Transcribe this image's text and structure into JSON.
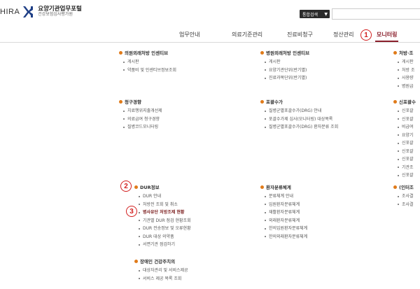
{
  "header": {
    "logo_left": "HIRA",
    "logo_title": "요양기관업무포털",
    "logo_sub": "건강보험심사평가원",
    "search_select": "통합검색",
    "search_input": ""
  },
  "nav": {
    "items": [
      "업무안내",
      "의료기준관리",
      "진료비청구",
      "정산관리",
      "모니터링"
    ],
    "active": "모니터링"
  },
  "annotations": [
    "1",
    "2",
    "3"
  ],
  "columns": {
    "col1": [
      {
        "title": "의원외래처방 인센티브",
        "items": [
          "게시판",
          "약품비 및 인센티브정보조회"
        ]
      },
      {
        "title": "청구경향",
        "items": [
          "치료행위지출개선제",
          "의료급여 청구경향",
          "질병코드모니터링"
        ]
      },
      {
        "title": "DUR정보",
        "items": [
          "DUR 안내",
          "처방전 조회 및 취소",
          "병사유단 처방조제 현황",
          "기관별 DUR 점검 현황조회",
          "DUR 전송정보 및 오류현황",
          "DUR 대상 의약품",
          "서면기관 점검하기"
        ],
        "highlight": 2
      },
      {
        "title": "장애인 건강주치의",
        "items": [
          "대상자관리 및 서비스제공",
          "서비스 제공 목록 조회"
        ]
      }
    ],
    "col2": [
      {
        "title": "병원외래처방 인센티브",
        "items": [
          "게시판",
          "요양기관단위(반기별)",
          "진료과목단위(반기별)"
        ]
      },
      {
        "title": "포괄수가",
        "items": [
          "질병군별포괄수가(DRG) 안내",
          "포괄수가제 심사(모니터링) 대상목록",
          "질병군별포괄수가(DRG) 환자분류 조회"
        ]
      },
      {
        "title": "환자분류체계",
        "items": [
          "분류체계 안내",
          "입원환자분류체계",
          "재활환자분류체계",
          "외래환자분류체계",
          "한의입원환자분류체계",
          "한의외래환자분류체계"
        ]
      }
    ],
    "col3": [
      {
        "title": "처방·조",
        "items": [
          "게시판",
          "처방 조",
          "사용량",
          "병원급"
        ]
      },
      {
        "title": "신포괄수",
        "items": [
          "신포괄",
          "신포괄",
          "비급여",
          "요양기",
          "신포괄",
          "신포괄",
          "신포괄",
          "기관조",
          "신포괄"
        ]
      },
      {
        "title": "(인터조",
        "items": [
          "조사결",
          "조사결"
        ]
      }
    ]
  },
  "colors": {
    "brand": "#8a1f2b",
    "bullet": "#e07b1a",
    "badge": "#d21e1e"
  }
}
